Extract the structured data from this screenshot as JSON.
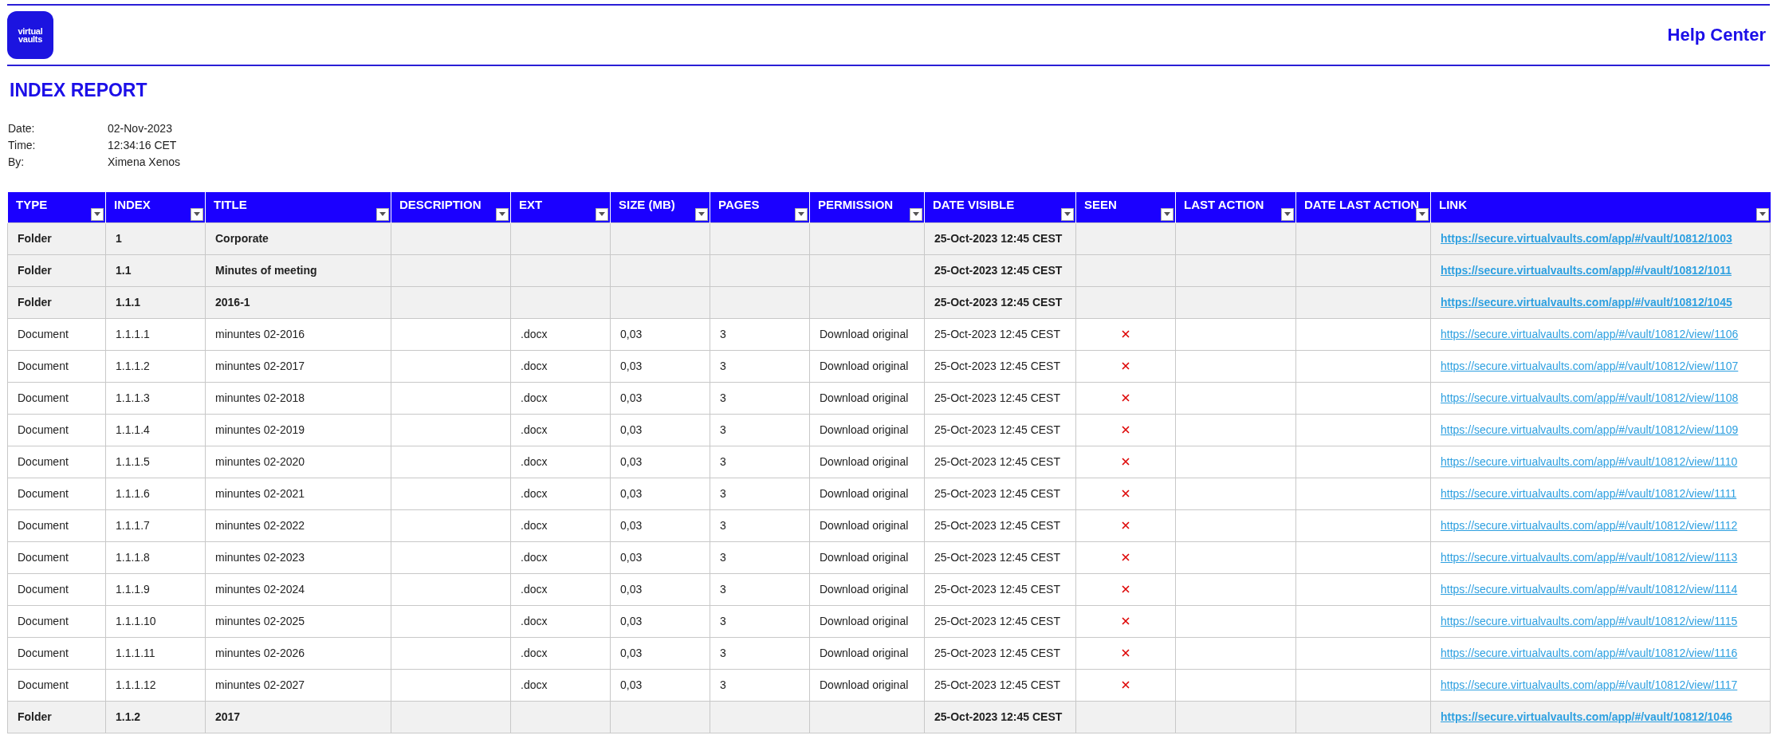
{
  "logo": {
    "text": [
      "virtual",
      "vaults"
    ]
  },
  "help_link": "Help Center",
  "title": "INDEX REPORT",
  "meta": [
    {
      "label": "Date:",
      "value": "02-Nov-2023"
    },
    {
      "label": "Time:",
      "value": "12:34:16 CET"
    },
    {
      "label": "By:",
      "value": "Ximena Xenos"
    }
  ],
  "table": {
    "columns": [
      "TYPE",
      "INDEX",
      "TITLE",
      "DESCRIPTION",
      "EXT",
      "SIZE (MB)",
      "PAGES",
      "PERMISSION",
      "DATE VISIBLE",
      "SEEN",
      "LAST ACTION",
      "DATE LAST ACTION",
      "LINK"
    ],
    "rows": [
      {
        "kind": "folder",
        "type": "Folder",
        "index": "1",
        "title": "Corporate",
        "date_visible": "25-Oct-2023 12:45 CEST",
        "link": "https://secure.virtualvaults.com/app/#/vault/10812/1003"
      },
      {
        "kind": "folder",
        "type": "Folder",
        "index": "1.1",
        "title": "Minutes of meeting",
        "date_visible": "25-Oct-2023 12:45 CEST",
        "link": "https://secure.virtualvaults.com/app/#/vault/10812/1011"
      },
      {
        "kind": "folder",
        "type": "Folder",
        "index": "1.1.1",
        "title": "2016-1",
        "date_visible": "25-Oct-2023 12:45 CEST",
        "link": "https://secure.virtualvaults.com/app/#/vault/10812/1045"
      },
      {
        "kind": "document",
        "type": "Document",
        "index": "1.1.1.1",
        "title": "minuntes 02-2016",
        "ext": ".docx",
        "size": "0,03",
        "pages": "3",
        "permission": "Download original",
        "date_visible": "25-Oct-2023 12:45 CEST",
        "seen": false,
        "link": "https://secure.virtualvaults.com/app/#/vault/10812/view/1106"
      },
      {
        "kind": "document",
        "type": "Document",
        "index": "1.1.1.2",
        "title": "minuntes 02-2017",
        "ext": ".docx",
        "size": "0,03",
        "pages": "3",
        "permission": "Download original",
        "date_visible": "25-Oct-2023 12:45 CEST",
        "seen": false,
        "link": "https://secure.virtualvaults.com/app/#/vault/10812/view/1107"
      },
      {
        "kind": "document",
        "type": "Document",
        "index": "1.1.1.3",
        "title": "minuntes 02-2018",
        "ext": ".docx",
        "size": "0,03",
        "pages": "3",
        "permission": "Download original",
        "date_visible": "25-Oct-2023 12:45 CEST",
        "seen": false,
        "link": "https://secure.virtualvaults.com/app/#/vault/10812/view/1108"
      },
      {
        "kind": "document",
        "type": "Document",
        "index": "1.1.1.4",
        "title": "minuntes 02-2019",
        "ext": ".docx",
        "size": "0,03",
        "pages": "3",
        "permission": "Download original",
        "date_visible": "25-Oct-2023 12:45 CEST",
        "seen": false,
        "link": "https://secure.virtualvaults.com/app/#/vault/10812/view/1109"
      },
      {
        "kind": "document",
        "type": "Document",
        "index": "1.1.1.5",
        "title": "minuntes 02-2020",
        "ext": ".docx",
        "size": "0,03",
        "pages": "3",
        "permission": "Download original",
        "date_visible": "25-Oct-2023 12:45 CEST",
        "seen": false,
        "link": "https://secure.virtualvaults.com/app/#/vault/10812/view/1110"
      },
      {
        "kind": "document",
        "type": "Document",
        "index": "1.1.1.6",
        "title": "minuntes 02-2021",
        "ext": ".docx",
        "size": "0,03",
        "pages": "3",
        "permission": "Download original",
        "date_visible": "25-Oct-2023 12:45 CEST",
        "seen": false,
        "link": "https://secure.virtualvaults.com/app/#/vault/10812/view/1111"
      },
      {
        "kind": "document",
        "type": "Document",
        "index": "1.1.1.7",
        "title": "minuntes 02-2022",
        "ext": ".docx",
        "size": "0,03",
        "pages": "3",
        "permission": "Download original",
        "date_visible": "25-Oct-2023 12:45 CEST",
        "seen": false,
        "link": "https://secure.virtualvaults.com/app/#/vault/10812/view/1112"
      },
      {
        "kind": "document",
        "type": "Document",
        "index": "1.1.1.8",
        "title": "minuntes 02-2023",
        "ext": ".docx",
        "size": "0,03",
        "pages": "3",
        "permission": "Download original",
        "date_visible": "25-Oct-2023 12:45 CEST",
        "seen": false,
        "link": "https://secure.virtualvaults.com/app/#/vault/10812/view/1113"
      },
      {
        "kind": "document",
        "type": "Document",
        "index": "1.1.1.9",
        "title": "minuntes 02-2024",
        "ext": ".docx",
        "size": "0,03",
        "pages": "3",
        "permission": "Download original",
        "date_visible": "25-Oct-2023 12:45 CEST",
        "seen": false,
        "link": "https://secure.virtualvaults.com/app/#/vault/10812/view/1114"
      },
      {
        "kind": "document",
        "type": "Document",
        "index": "1.1.1.10",
        "title": "minuntes 02-2025",
        "ext": ".docx",
        "size": "0,03",
        "pages": "3",
        "permission": "Download original",
        "date_visible": "25-Oct-2023 12:45 CEST",
        "seen": false,
        "link": "https://secure.virtualvaults.com/app/#/vault/10812/view/1115"
      },
      {
        "kind": "document",
        "type": "Document",
        "index": "1.1.1.11",
        "title": "minuntes 02-2026",
        "ext": ".docx",
        "size": "0,03",
        "pages": "3",
        "permission": "Download original",
        "date_visible": "25-Oct-2023 12:45 CEST",
        "seen": false,
        "link": "https://secure.virtualvaults.com/app/#/vault/10812/view/1116"
      },
      {
        "kind": "document",
        "type": "Document",
        "index": "1.1.1.12",
        "title": "minuntes 02-2027",
        "ext": ".docx",
        "size": "0,03",
        "pages": "3",
        "permission": "Download original",
        "date_visible": "25-Oct-2023 12:45 CEST",
        "seen": false,
        "link": "https://secure.virtualvaults.com/app/#/vault/10812/view/1117"
      },
      {
        "kind": "folder",
        "type": "Folder",
        "index": "1.1.2",
        "title": "2017",
        "date_visible": "25-Oct-2023 12:45 CEST",
        "link": "https://secure.virtualvaults.com/app/#/vault/10812/1046"
      }
    ]
  }
}
